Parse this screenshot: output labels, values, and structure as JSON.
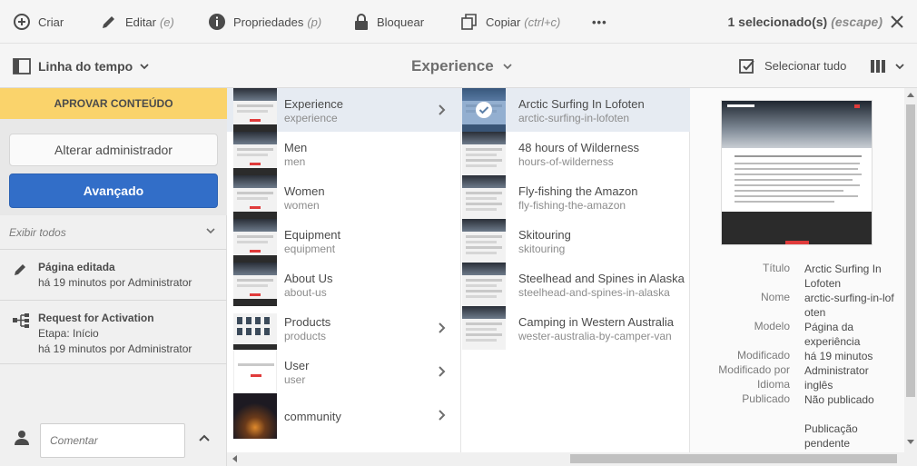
{
  "actionbar": {
    "create": "Criar",
    "edit": "Editar",
    "edit_hint": "(e)",
    "properties": "Propriedades",
    "properties_hint": "(p)",
    "lock": "Bloquear",
    "copy": "Copiar",
    "copy_hint": "(ctrl+c)",
    "more": "•••",
    "selection": "1 selecionado(s)",
    "selection_hint": "(escape)"
  },
  "header": {
    "rail_label": "Linha do tempo",
    "title": "Experience",
    "select_all": "Selecionar tudo"
  },
  "rail": {
    "banner": "APROVAR CONTEÚDO",
    "secondary_button": "Alterar administrador",
    "primary_button": "Avançado",
    "filter": "Exibir todos",
    "items": [
      {
        "title": "Página editada",
        "lines": [
          "há 19 minutos por Administrator"
        ]
      },
      {
        "title": "Request for Activation",
        "lines": [
          "Etapa: Início",
          "há 19 minutos por Administrator"
        ]
      }
    ],
    "comment_placeholder": "Comentar"
  },
  "column1": [
    {
      "name": "Experience",
      "sub": "experience",
      "has_children": true,
      "selected": true
    },
    {
      "name": "Men",
      "sub": "men",
      "has_children": false
    },
    {
      "name": "Women",
      "sub": "women",
      "has_children": false
    },
    {
      "name": "Equipment",
      "sub": "equipment",
      "has_children": false
    },
    {
      "name": "About Us",
      "sub": "about-us",
      "has_children": false
    },
    {
      "name": "Products",
      "sub": "products",
      "has_children": true
    },
    {
      "name": "User",
      "sub": "user",
      "has_children": true
    },
    {
      "name": "community",
      "sub": "",
      "has_children": true
    }
  ],
  "column2": [
    {
      "name": "Arctic Surfing In Lofoten",
      "sub": "arctic-surfing-in-lofoten",
      "selected": true
    },
    {
      "name": "48 hours of Wilderness",
      "sub": "hours-of-wilderness"
    },
    {
      "name": "Fly-fishing the Amazon",
      "sub": "fly-fishing-the-amazon"
    },
    {
      "name": "Skitouring",
      "sub": "skitouring"
    },
    {
      "name": "Steelhead and Spines in Alaska",
      "sub": "steelhead-and-spines-in-alaska"
    },
    {
      "name": "Camping in Western Australia",
      "sub": "wester-australia-by-camper-van"
    }
  ],
  "preview": {
    "meta": [
      {
        "label": "Título",
        "value": "Arctic Surfing In Lofoten"
      },
      {
        "label": "Nome",
        "value": "arctic-surfing-in-lofoten"
      },
      {
        "label": "Modelo",
        "value": "Página da experiência"
      },
      {
        "label": "Modificado",
        "value": "há 19 minutos"
      },
      {
        "label": "Modificado por",
        "value": "Administrator"
      },
      {
        "label": "Idioma",
        "value": "inglês"
      },
      {
        "label": "Publicado",
        "value": "Não publicado"
      },
      {
        "label": "",
        "value": "Publicação pendente"
      }
    ]
  },
  "colors": {
    "accent": "#326ec8",
    "approve_banner": "#fad36b",
    "selected_row": "#e6ebf2"
  }
}
